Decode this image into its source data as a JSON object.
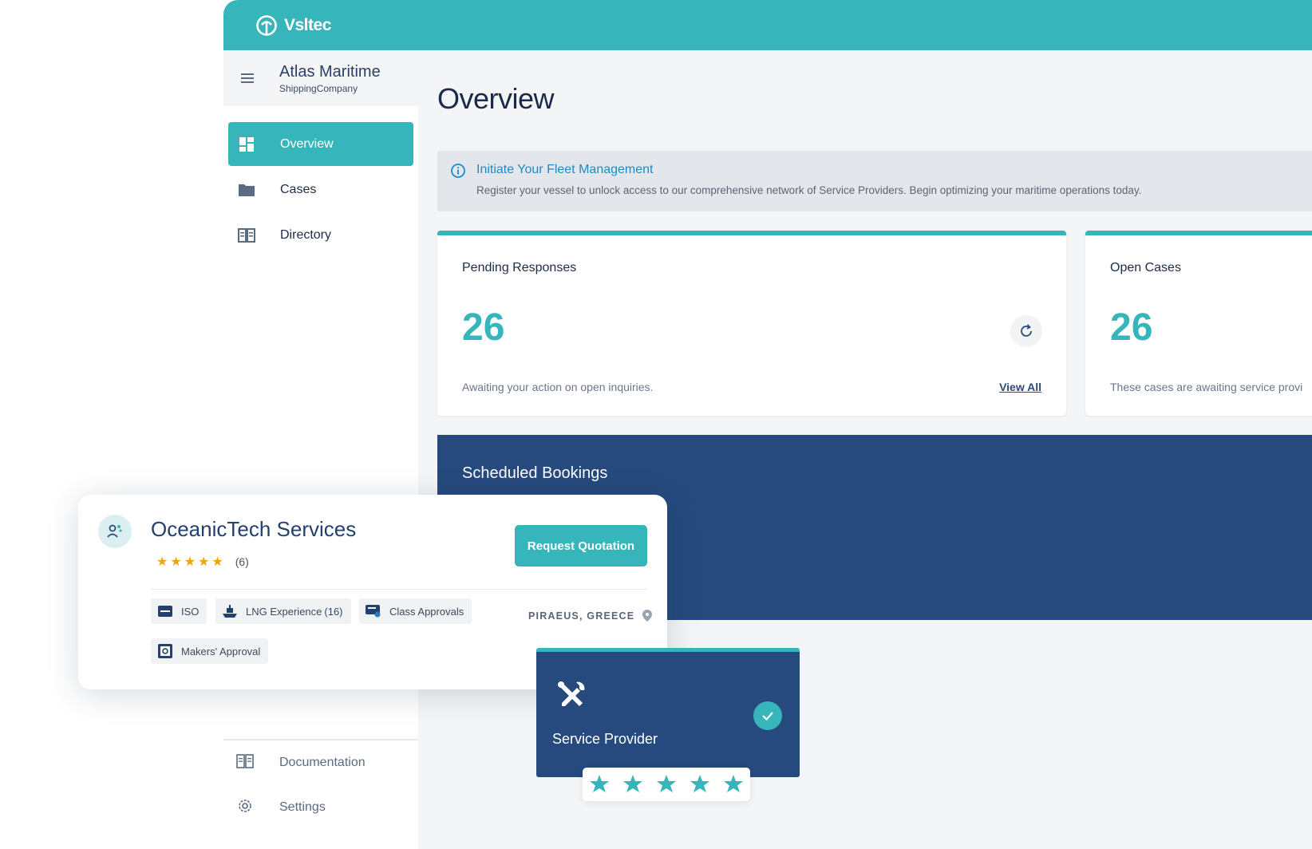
{
  "brand": {
    "name": "Vsltec",
    "color": "#36b5bb"
  },
  "org": {
    "name": "Atlas Maritime",
    "type": "ShippingCompany"
  },
  "nav": {
    "items": [
      {
        "label": "Overview",
        "icon": "dashboard-icon",
        "active": true
      },
      {
        "label": "Cases",
        "icon": "folder-icon",
        "active": false
      },
      {
        "label": "Directory",
        "icon": "book-icon",
        "active": false
      }
    ],
    "bottom": [
      {
        "label": "Documentation",
        "icon": "document-icon"
      },
      {
        "label": "Settings",
        "icon": "gear-icon"
      }
    ]
  },
  "page": {
    "title": "Overview"
  },
  "banner": {
    "title": "Initiate Your Fleet Management",
    "text": "Register your vessel to unlock access to our comprehensive network of Service Providers. Begin optimizing your maritime operations today."
  },
  "stats": {
    "pending": {
      "title": "Pending Responses",
      "value": "26",
      "desc": "Awaiting your action on open inquiries.",
      "link": "View All"
    },
    "open": {
      "title": "Open Cases",
      "value": "26",
      "desc": "These cases are awaiting service provi"
    }
  },
  "bookings": {
    "title": "Scheduled Bookings"
  },
  "provider": {
    "name": "OceanicTech Services",
    "rating": 5,
    "review_count": "(6)",
    "button": "Request Quotation",
    "tags": [
      {
        "label": "ISO",
        "count": ""
      },
      {
        "label": "LNG Experience",
        "count": "(16)"
      },
      {
        "label": "Class Approvals",
        "count": ""
      },
      {
        "label": "Makers' Approval",
        "count": ""
      }
    ],
    "location": "PIRAEUS, GREECE"
  },
  "badge": {
    "label": "Service Provider",
    "stars": 5
  },
  "colors": {
    "accent": "#36b5bb",
    "navy": "#264a7e",
    "star": "#f2a20a"
  }
}
